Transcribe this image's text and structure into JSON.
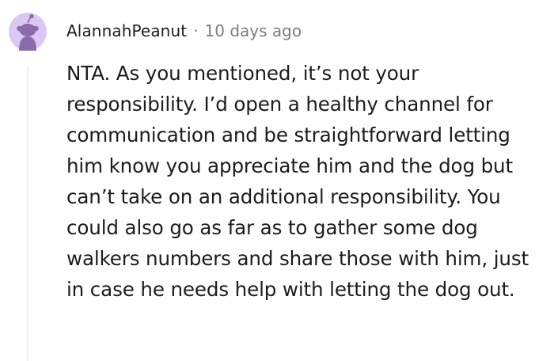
{
  "comment": {
    "author": "AlannahPeanut",
    "separator": "·",
    "timestamp": "10 days ago",
    "body": "NTA. As you mentioned, it’s not your responsibility. I’d open a healthy channel for communication and be straightforward letting him know you appreciate him and the dog but can’t take on an additional responsibility. You could also go as far as to gather some dog walkers numbers and share those with him, just in case he needs help with letting the dog out."
  },
  "avatar": {
    "icon": "snoo-avatar-icon",
    "background_color": "#dcc6f4",
    "figure_color": "#8a6ca8"
  },
  "colors": {
    "text": "#1c1c1c",
    "meta": "#7c7c7c",
    "thread_line": "#edeff1"
  }
}
